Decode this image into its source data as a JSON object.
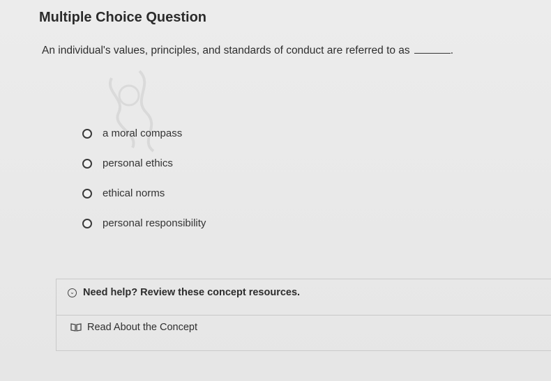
{
  "header": {
    "title": "Multiple Choice Question"
  },
  "question": {
    "text": "An individual's values, principles, and standards of conduct are referred to as",
    "end_punct": "."
  },
  "options": [
    {
      "label": "a moral compass"
    },
    {
      "label": "personal ethics"
    },
    {
      "label": "ethical norms"
    },
    {
      "label": "personal responsibility"
    }
  ],
  "help": {
    "toggle_label": "Need help? Review these concept resources.",
    "toggle_icon": "chevron-down-circle-icon",
    "resource_label": "Read About the Concept",
    "resource_icon": "book-icon"
  }
}
